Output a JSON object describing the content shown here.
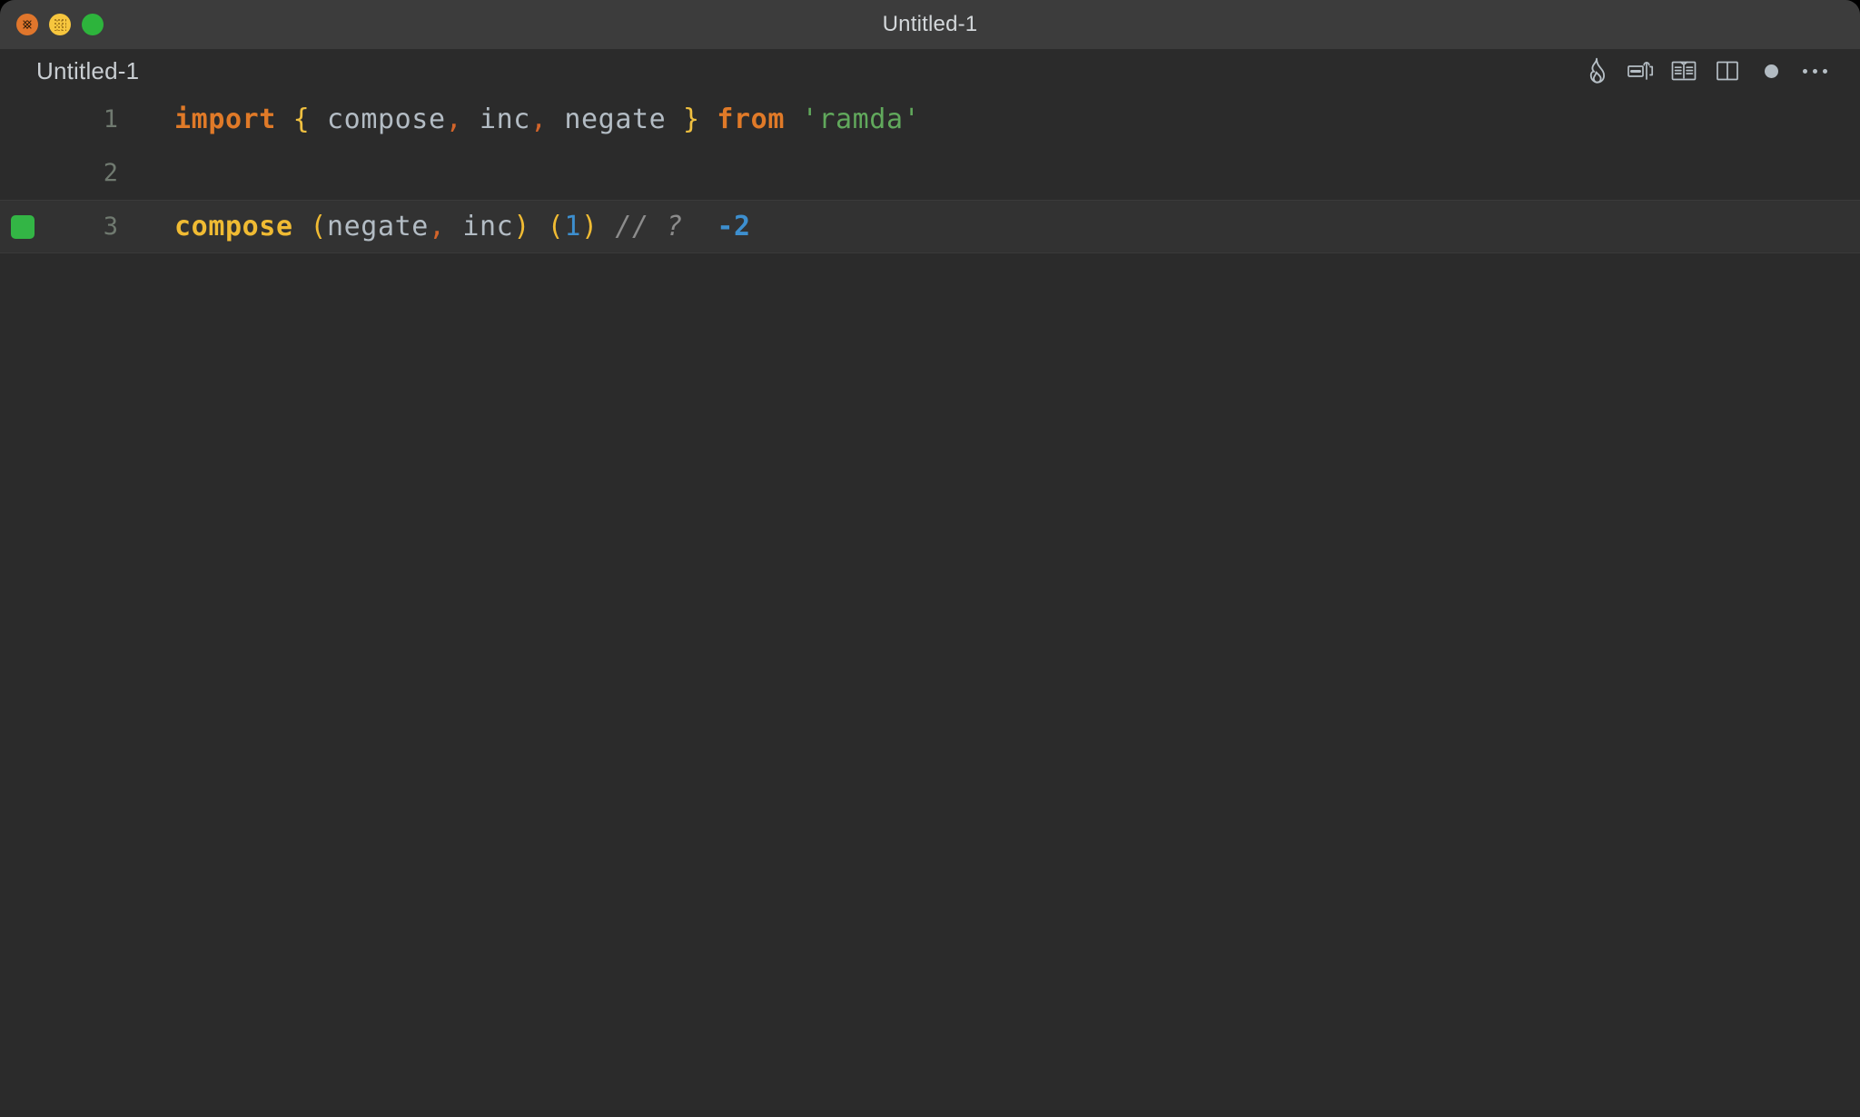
{
  "window": {
    "title": "Untitled-1",
    "traffic_lights": [
      {
        "name": "close",
        "color": "#e0762c"
      },
      {
        "name": "minimize",
        "color": "#f7c63e"
      },
      {
        "name": "maximize",
        "color": "#2db43c"
      }
    ]
  },
  "tab": {
    "label": "Untitled-1"
  },
  "toolbar": {
    "items": [
      {
        "name": "quokka-flame-icon",
        "tooltip": "Quokka"
      },
      {
        "name": "code-snippet-icon",
        "tooltip": "Run Code"
      },
      {
        "name": "open-book-icon",
        "tooltip": "Open Preview"
      },
      {
        "name": "split-editor-icon",
        "tooltip": "Split Editor"
      },
      {
        "name": "unsaved-dot-icon",
        "tooltip": "Unsaved Changes"
      },
      {
        "name": "more-actions-icon",
        "tooltip": "More Actions..."
      }
    ]
  },
  "editor": {
    "language": "javascript",
    "active_line": 3,
    "gutter_marker": {
      "line": 3,
      "color": "#33b545"
    },
    "lines": [
      {
        "number": "1",
        "tokens": [
          {
            "text": "import",
            "type": "keyword"
          },
          {
            "text": " ",
            "type": "plain"
          },
          {
            "text": "{",
            "type": "brace"
          },
          {
            "text": " ",
            "type": "plain"
          },
          {
            "text": "compose",
            "type": "ident"
          },
          {
            "text": ",",
            "type": "punct"
          },
          {
            "text": " ",
            "type": "plain"
          },
          {
            "text": "inc",
            "type": "ident"
          },
          {
            "text": ",",
            "type": "punct"
          },
          {
            "text": " ",
            "type": "plain"
          },
          {
            "text": "negate",
            "type": "ident"
          },
          {
            "text": " ",
            "type": "plain"
          },
          {
            "text": "}",
            "type": "brace"
          },
          {
            "text": " ",
            "type": "plain"
          },
          {
            "text": "from",
            "type": "keyword"
          },
          {
            "text": " ",
            "type": "plain"
          },
          {
            "text": "'ramda'",
            "type": "string"
          }
        ]
      },
      {
        "number": "2",
        "tokens": []
      },
      {
        "number": "3",
        "tokens": [
          {
            "text": "compose",
            "type": "func"
          },
          {
            "text": " ",
            "type": "plain"
          },
          {
            "text": "(",
            "type": "paren"
          },
          {
            "text": "negate",
            "type": "ident"
          },
          {
            "text": ",",
            "type": "punct"
          },
          {
            "text": " ",
            "type": "plain"
          },
          {
            "text": "inc",
            "type": "ident"
          },
          {
            "text": ")",
            "type": "paren"
          },
          {
            "text": " ",
            "type": "plain"
          },
          {
            "text": "(",
            "type": "paren"
          },
          {
            "text": "1",
            "type": "number"
          },
          {
            "text": ")",
            "type": "paren"
          },
          {
            "text": " ",
            "type": "plain"
          },
          {
            "text": "//",
            "type": "comment"
          },
          {
            "text": " ",
            "type": "plain"
          },
          {
            "text": "?",
            "type": "comment"
          },
          {
            "text": "  ",
            "type": "plain"
          },
          {
            "text": "-2",
            "type": "result"
          }
        ]
      }
    ]
  },
  "colors": {
    "window_chrome": "#3c3c3c",
    "editor_background": "#2b2b2b",
    "active_line": "#323232",
    "keyword": "#e07a28",
    "string": "#61a95c",
    "function": "#f0bb33",
    "number": "#3d8fcf",
    "comment": "#8c8c8c",
    "identifier": "#b3bcc4"
  }
}
